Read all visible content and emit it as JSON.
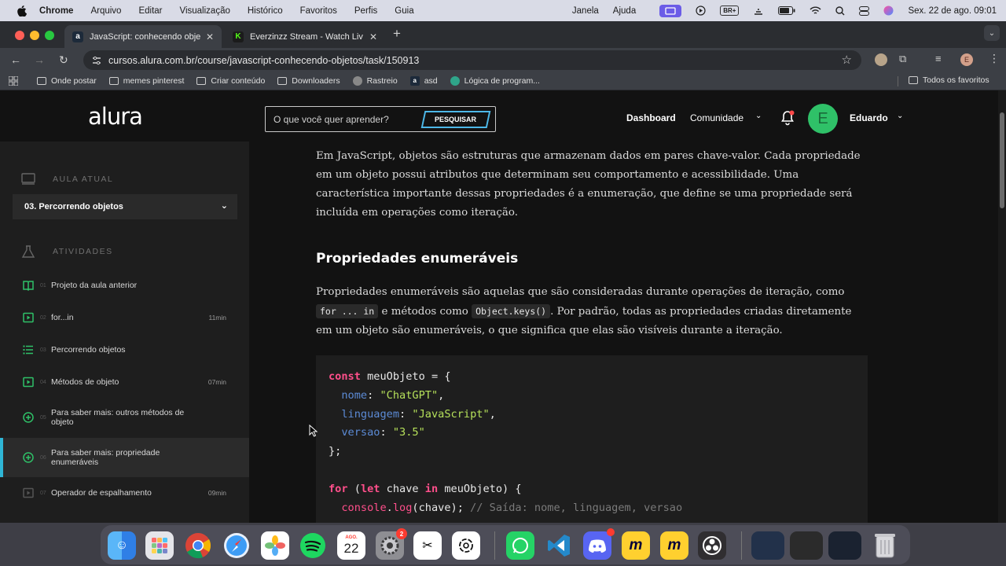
{
  "menubar": {
    "app": "Chrome",
    "items": [
      "Arquivo",
      "Editar",
      "Visualização",
      "Histórico",
      "Favoritos",
      "Perfis",
      "Guia"
    ],
    "right_items": [
      "Janela",
      "Ajuda"
    ],
    "keyboard": "BR+",
    "datetime": "Sex. 22 de ago.  09:01"
  },
  "tabs": [
    {
      "title": "JavaScript: conhecendo obje",
      "favicon": "a",
      "active": true
    },
    {
      "title": "Everzinzz Stream - Watch Liv",
      "favicon": "K",
      "active": false
    }
  ],
  "address": {
    "url": "cursos.alura.com.br/course/javascript-conhecendo-objetos/task/150913"
  },
  "bookmarks": {
    "items": [
      {
        "label": "Onde postar",
        "icon": "folder-icon"
      },
      {
        "label": "memes pinterest",
        "icon": "folder-icon"
      },
      {
        "label": "Criar conteúdo",
        "icon": "folder-icon"
      },
      {
        "label": "Downloaders",
        "icon": "folder-icon"
      },
      {
        "label": "Rastreio",
        "icon": "globe-icon"
      },
      {
        "label": "asd",
        "icon": "alura-icon"
      },
      {
        "label": "Lógica de program...",
        "icon": "alura-icon"
      }
    ],
    "all": "Todos os favoritos"
  },
  "topnav": {
    "logo": "alura",
    "search_placeholder": "O que você quer aprender?",
    "search_button": "PESQUISAR",
    "dashboard": "Dashboard",
    "community": "Comunidade",
    "avatar_letter": "E",
    "username": "Eduardo"
  },
  "sidebar": {
    "current_lesson_header": "AULA ATUAL",
    "current_lesson": "03. Percorrendo objetos",
    "activities_header": "ATIVIDADES",
    "items": [
      {
        "num": "01",
        "label": "Projeto da aula anterior",
        "duration": "",
        "icon": "book-icon"
      },
      {
        "num": "02",
        "label": "for...in",
        "duration": "11min",
        "icon": "video-icon"
      },
      {
        "num": "03",
        "label": "Percorrendo objetos",
        "duration": "",
        "icon": "list-icon"
      },
      {
        "num": "04",
        "label": "Métodos de objeto",
        "duration": "07min",
        "icon": "video-icon"
      },
      {
        "num": "05",
        "label": "Para saber mais: outros métodos de objeto",
        "duration": "",
        "icon": "plus-circle-icon"
      },
      {
        "num": "06",
        "label": "Para saber mais: propriedade enumeráveis",
        "duration": "",
        "icon": "plus-circle-icon"
      },
      {
        "num": "07",
        "label": "Operador de espalhamento",
        "duration": "09min",
        "icon": "video-icon"
      }
    ]
  },
  "content": {
    "intro": "Em JavaScript, objetos são estruturas que armazenam dados em pares chave-valor. Cada propriedade em um objeto possui atributos que determinam seu comportamento e acessibilidade. Uma característica importante dessas propriedades é a enumeração, que define se uma propriedade será incluída em operações como iteração.",
    "heading": "Propriedades enumeráveis",
    "p2_before": "Propriedades enumeráveis são aquelas que são consideradas durante operações de iteração, como ",
    "p2_code1": "for ... in",
    "p2_mid": " e métodos como ",
    "p2_code2": "Object.keys()",
    "p2_after": ". Por padrão, todas as propriedades criadas diretamente em um objeto são enumeráveis, o que significa que elas são visíveis durante a iteração.",
    "code": {
      "kw_const": "const",
      "obj_decl": " meuObjeto = {",
      "p1": "nome",
      "v1": "\"ChatGPT\"",
      "p2": "linguagem",
      "v2": "\"JavaScript\"",
      "p3": "versao",
      "v3": "\"3.5\"",
      "close": "};",
      "kw_for": "for",
      "kw_let": "let",
      "kw_in": "in",
      "for_var": " chave ",
      "for_obj": " meuObjeto) {",
      "console": "console",
      "log": "log",
      "log_arg": "(chave);",
      "comment": "// Saída: nome, linguagem, versao"
    }
  },
  "dock": {
    "calendar_month": "AGO.",
    "calendar_day": "22",
    "badge_settings": "2"
  }
}
